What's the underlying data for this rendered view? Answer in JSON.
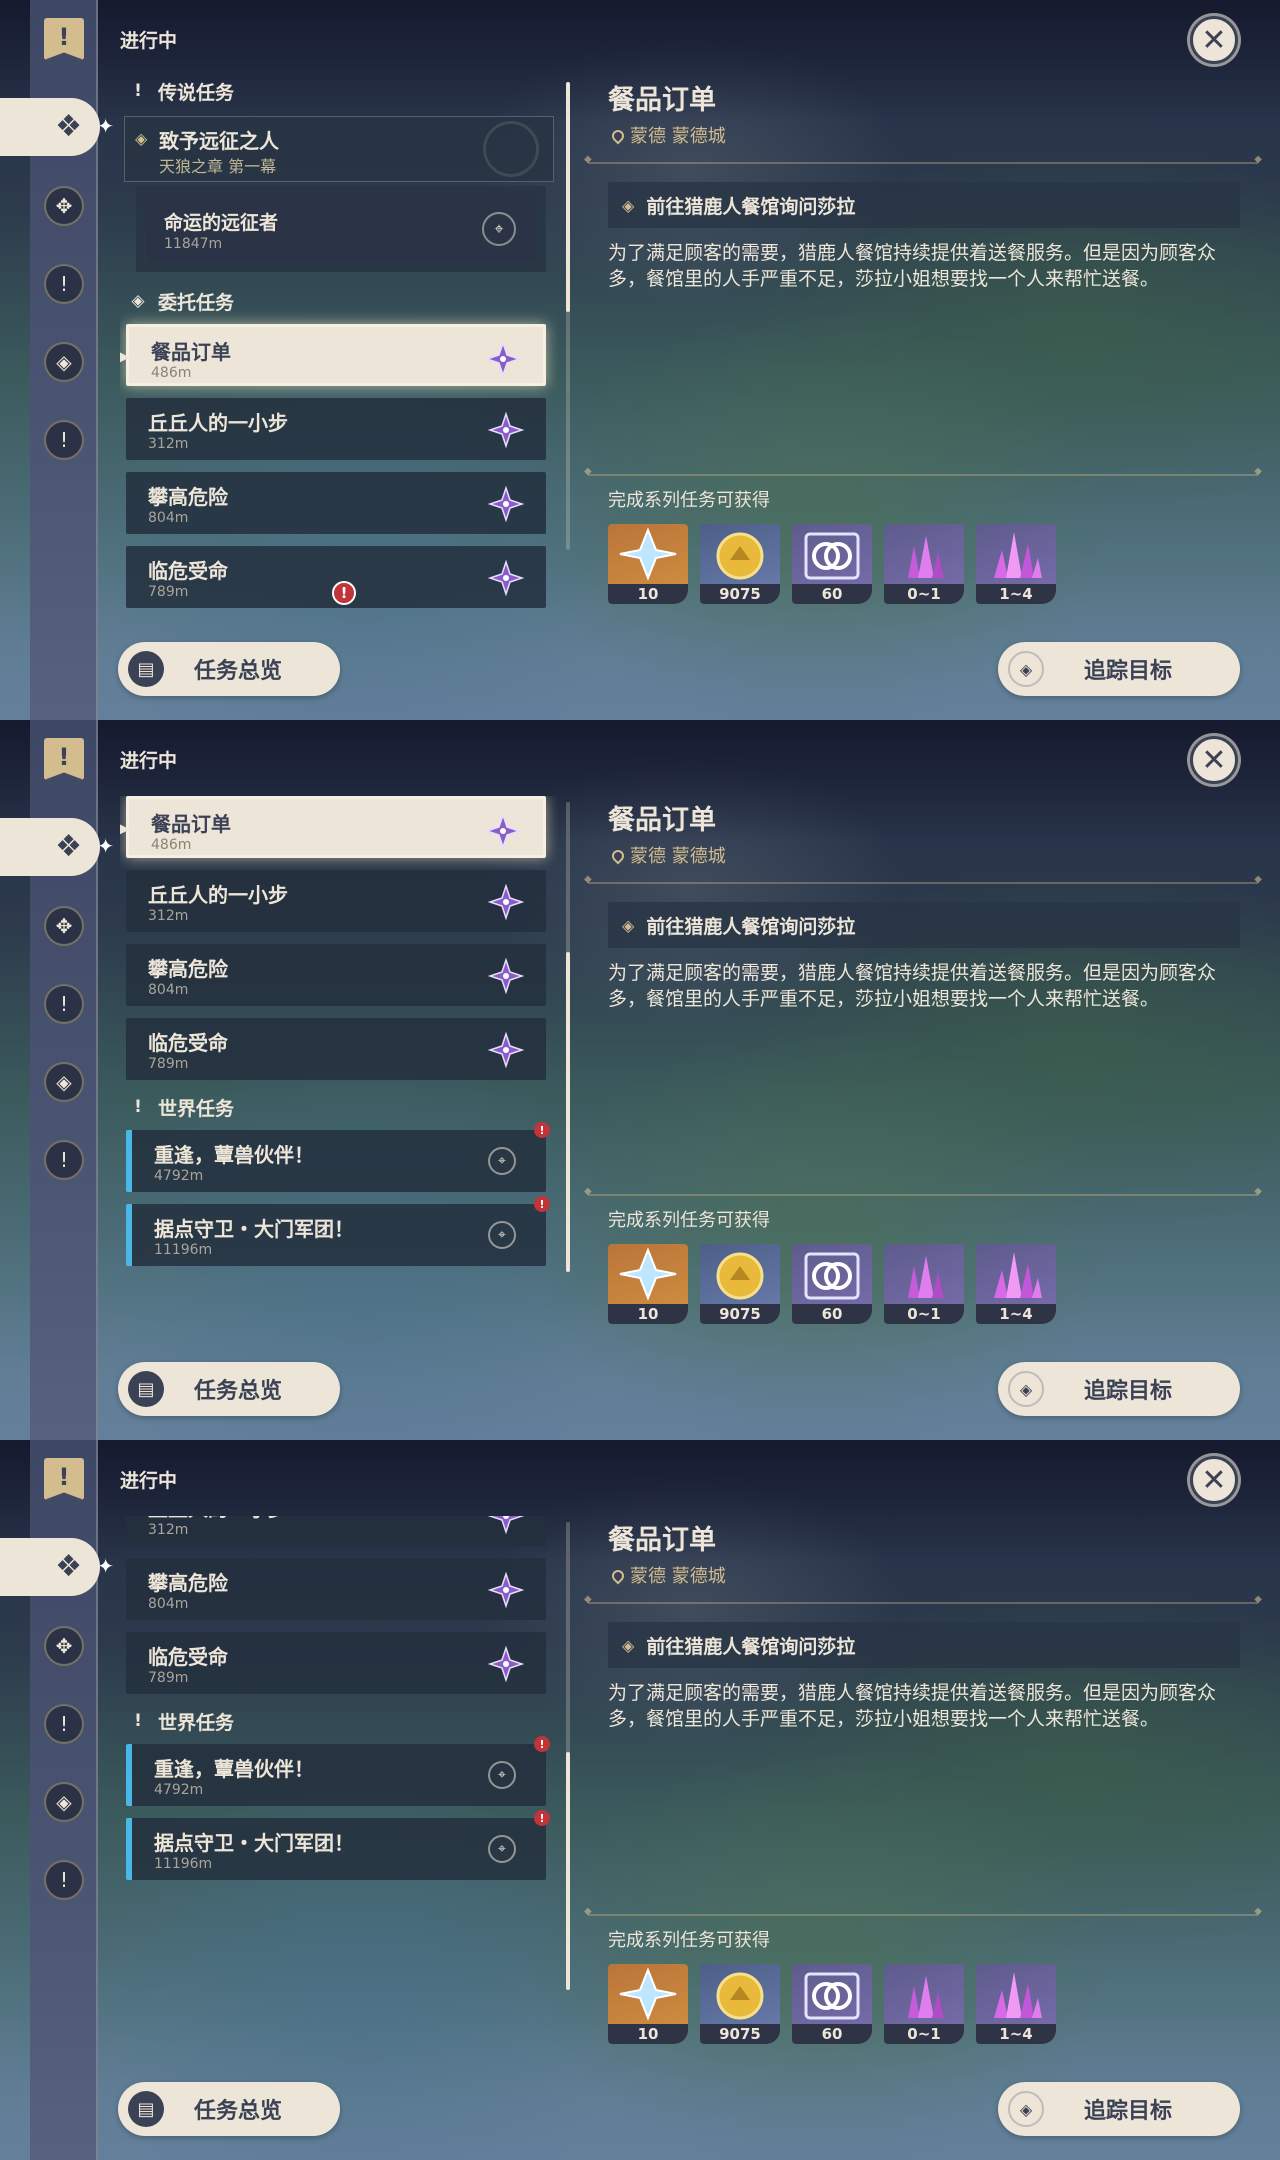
{
  "status_label": "进行中",
  "rail_icons": [
    "bookmark-icon",
    "commission-icon",
    "archon-icon",
    "world-quest-icon",
    "story-icon",
    "alert-icon"
  ],
  "sections": {
    "archon": "传说任务",
    "commission": "委托任务",
    "world": "世界任务"
  },
  "legend_quest": {
    "title": "致予远征之人",
    "subtitle": "天狼之章 第一幕",
    "sub_title": "命运的远征者",
    "sub_distance": "11847m"
  },
  "commissions": [
    {
      "title": "餐品订单",
      "distance": "486m"
    },
    {
      "title": "丘丘人的一小步",
      "distance": "312m"
    },
    {
      "title": "攀高危险",
      "distance": "804m"
    },
    {
      "title": "临危受命",
      "distance": "789m"
    }
  ],
  "world_quests": [
    {
      "title": "重逢，蕈兽伙伴！",
      "distance": "4792m"
    },
    {
      "title": "据点守卫・大门军团！",
      "distance": "11196m"
    }
  ],
  "detail": {
    "title": "餐品订单",
    "location": "蒙德 蒙德城",
    "objective": "前往猎鹿人餐馆询问莎拉",
    "description": "为了满足顾客的需要，猎鹿人餐馆持续提供着送餐服务。但是因为顾客众多，餐馆里的人手严重不足，莎拉小姐想要找一个人来帮忙送餐。",
    "rewards_label": "完成系列任务可获得",
    "rewards": [
      {
        "icon": "primogem-icon",
        "qty": "10"
      },
      {
        "icon": "mora-icon",
        "qty": "9075"
      },
      {
        "icon": "friendship-exp-icon",
        "qty": "60"
      },
      {
        "icon": "crystal-ore-icon",
        "qty": "0~1"
      },
      {
        "icon": "crystal-chunk-icon",
        "qty": "1~4"
      }
    ]
  },
  "buttons": {
    "overview": "任务总览",
    "track": "追踪目标"
  },
  "colors": {
    "panel_cream": "#ece5d8",
    "dark_slate": "#3b4255",
    "gold": "#d3bc8e",
    "world_quest_accent": "#4ab8e6",
    "alert_red": "#c0343a"
  }
}
